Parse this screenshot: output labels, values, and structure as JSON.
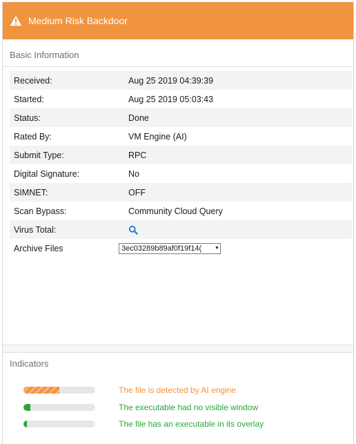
{
  "header": {
    "title": "Medium Risk Backdoor",
    "accent_color": "#f0943f",
    "icon": "warning-icon"
  },
  "basic_info": {
    "title": "Basic Information",
    "rows": [
      {
        "label": "Received:",
        "value": "Aug 25 2019 04:39:39"
      },
      {
        "label": "Started:",
        "value": "Aug 25 2019 05:03:43"
      },
      {
        "label": "Status:",
        "value": "Done"
      },
      {
        "label": "Rated By:",
        "value": "VM Engine (AI)"
      },
      {
        "label": "Submit Type:",
        "value": "RPC"
      },
      {
        "label": "Digital Signature:",
        "value": "No"
      },
      {
        "label": "SIMNET:",
        "value": "OFF"
      },
      {
        "label": "Scan Bypass:",
        "value": "Community Cloud Query"
      }
    ],
    "virus_total": {
      "label": "Virus Total:",
      "icon": "search-icon"
    },
    "archive_files": {
      "label": "Archive Files",
      "selected": "3ec03289b89af0f19f14("
    }
  },
  "indicators": {
    "title": "Indicators",
    "items": [
      {
        "text": "The file is detected by AI engine",
        "level": 0.5,
        "color": "#f0943f"
      },
      {
        "text": "The executable had no visible window",
        "level": 0.1,
        "color": "#2aa63a"
      },
      {
        "text": "The file has an executable in its overlay",
        "level": 0.05,
        "color": "#2aa63a"
      }
    ]
  }
}
